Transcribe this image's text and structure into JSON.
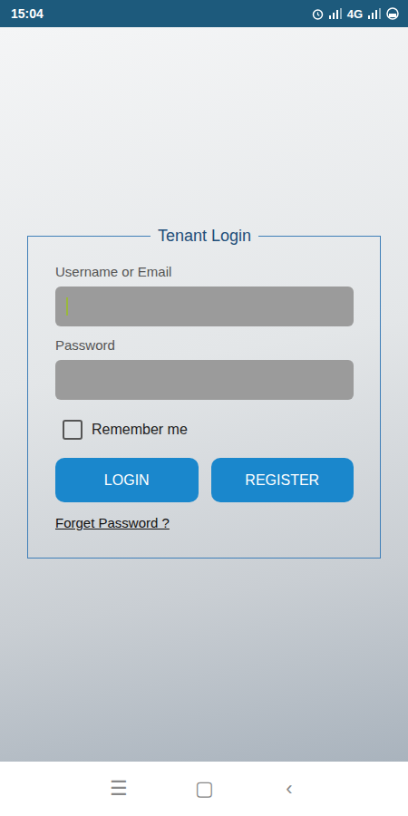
{
  "status_bar": {
    "time": "15:04",
    "network": "4G"
  },
  "login": {
    "title": "Tenant Login",
    "fields": [
      {
        "label": "Username or Email",
        "value": "",
        "focused": true,
        "kind": "text"
      },
      {
        "label": "Password",
        "value": "",
        "focused": false,
        "kind": "password"
      }
    ],
    "remember_me": {
      "label": "Remember me",
      "checked": false
    },
    "buttons": [
      {
        "label": "LOGIN"
      },
      {
        "label": "REGISTER"
      }
    ],
    "forgot_link": "Forget Password ?"
  },
  "nav_bar": {
    "buttons": [
      "☰",
      "▢",
      "‹"
    ]
  }
}
